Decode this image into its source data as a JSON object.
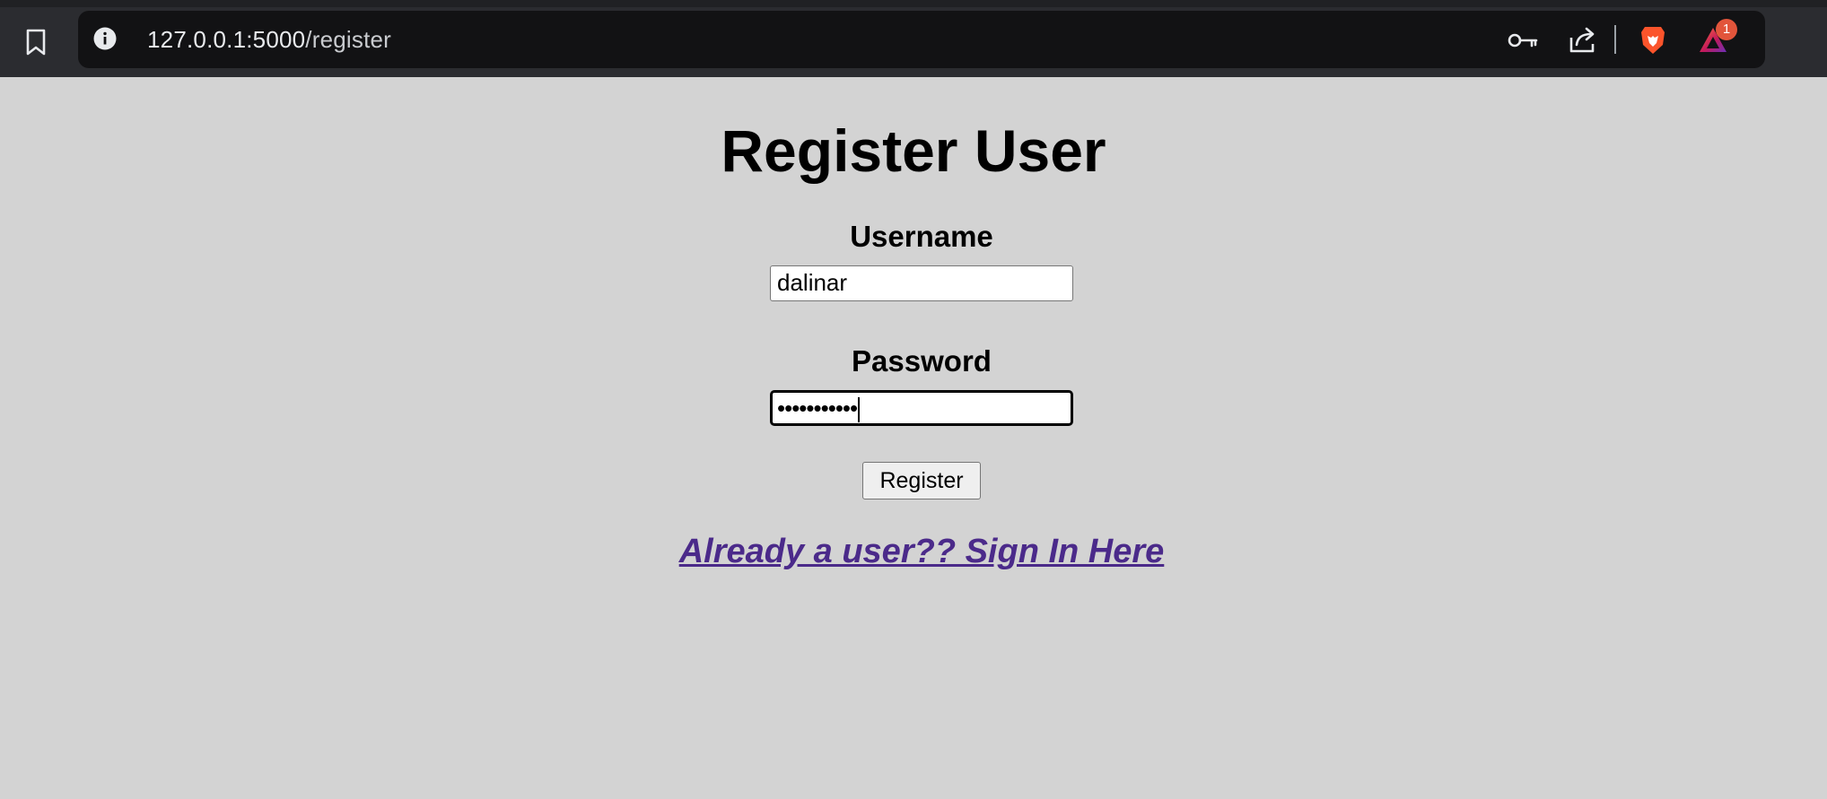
{
  "browser": {
    "url_host": "127.0.0.1:5000",
    "url_path": "/register",
    "rewards_badge_count": "1",
    "icons": [
      "bookmark-icon",
      "info-icon",
      "key-icon",
      "share-icon",
      "brave-lion-icon",
      "brave-rewards-icon"
    ]
  },
  "page": {
    "title": "Register User",
    "username_label": "Username",
    "username_value": "dalinar",
    "password_label": "Password",
    "password_masked": "•••••••••••",
    "register_button": "Register",
    "signin_link": "Already a user?? Sign In Here"
  },
  "colors": {
    "page_background": "#d3d3d3",
    "link": "#4b2a8a",
    "brave_orange": "#fb542b",
    "badge": "#e2553b"
  }
}
